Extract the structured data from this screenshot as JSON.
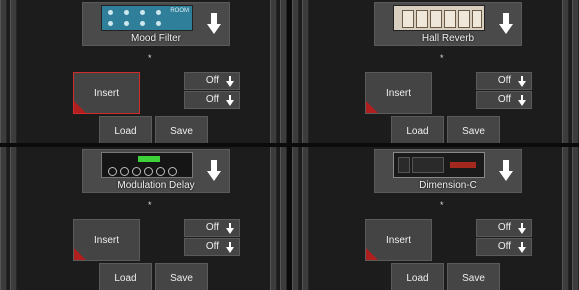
{
  "panels": [
    {
      "plugin_name": "Mood Filter",
      "thumb_text": "ROOM",
      "star": "*",
      "insert_label": "Insert",
      "toggle1": "Off",
      "toggle2": "Off",
      "load": "Load",
      "save": "Save"
    },
    {
      "plugin_name": "Hall Reverb",
      "star": "*",
      "insert_label": "Insert",
      "toggle1": "Off",
      "toggle2": "Off",
      "load": "Load",
      "save": "Save"
    },
    {
      "plugin_name": "Modulation Delay",
      "star": "*",
      "insert_label": "Insert",
      "toggle1": "Off",
      "toggle2": "Off",
      "load": "Load",
      "save": "Save"
    },
    {
      "plugin_name": "Dimension-C",
      "star": "*",
      "insert_label": "Insert",
      "toggle1": "Off",
      "toggle2": "Off",
      "load": "Load",
      "save": "Save"
    }
  ],
  "colors": {
    "accent_red": "#d12b2b",
    "panel_bg": "#1c1c1c",
    "button_bg": "#444444"
  },
  "icons": {
    "plugin_arrow": "arrow-down-icon",
    "toggle_arrow": "arrow-down-icon"
  }
}
